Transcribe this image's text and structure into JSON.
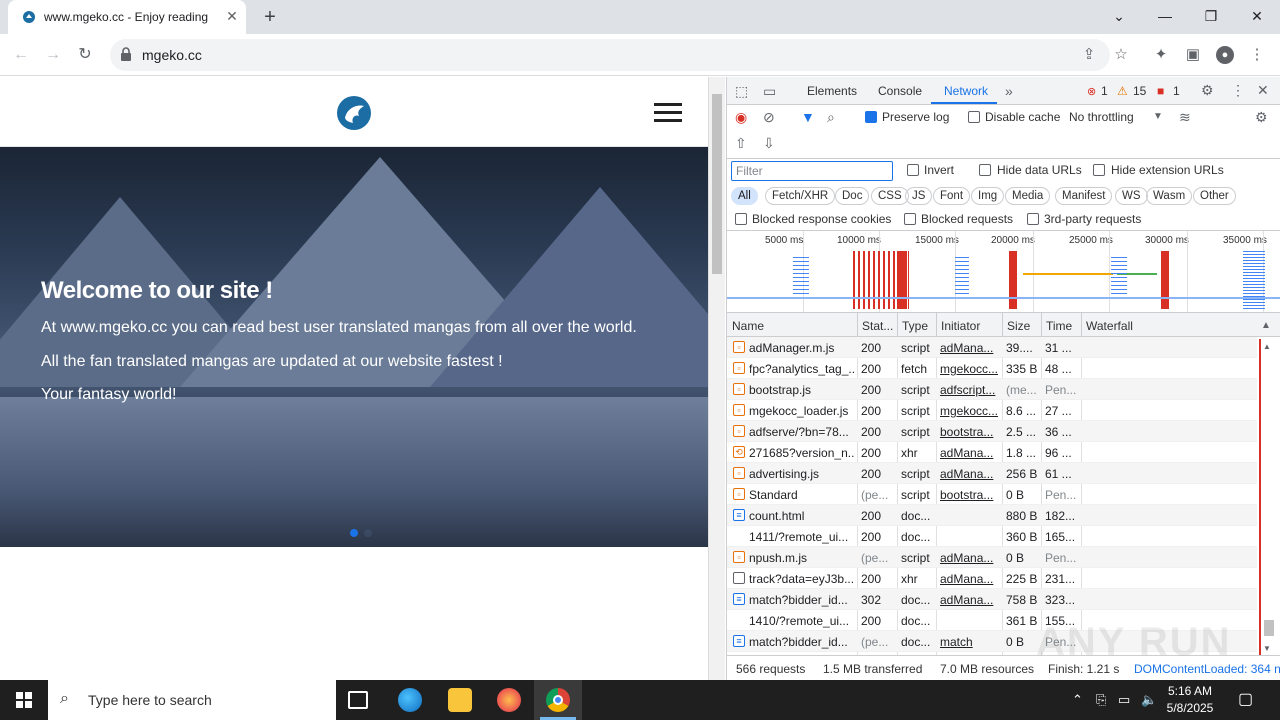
{
  "browser": {
    "tab_title": "www.mgeko.cc - Enjoy reading",
    "url": "mgeko.cc"
  },
  "page": {
    "hero_title": "Welcome to our site !",
    "hero_line1": "At www.mgeko.cc you can read best user translated mangas from all over the world.",
    "hero_line2": "All the fan translated mangas are updated at our website fastest !",
    "hero_line3": "Your fantasy world!"
  },
  "devtools": {
    "tabs": [
      "Elements",
      "Console",
      "Network"
    ],
    "active_tab": "Network",
    "errors": "1",
    "warnings": "15",
    "issues": "1",
    "preserve_log": "Preserve log",
    "disable_cache": "Disable cache",
    "throttling": "No throttling",
    "filter_placeholder": "Filter",
    "invert": "Invert",
    "hide_data_urls": "Hide data URLs",
    "hide_extension_urls": "Hide extension URLs",
    "type_filters": [
      "All",
      "Fetch/XHR",
      "Doc",
      "CSS",
      "JS",
      "Font",
      "Img",
      "Media",
      "Manifest",
      "WS",
      "Wasm",
      "Other"
    ],
    "blocked_cookies": "Blocked response cookies",
    "blocked_requests": "Blocked requests",
    "third_party": "3rd-party requests",
    "timeline_labels": [
      "5000 ms",
      "10000 ms",
      "15000 ms",
      "20000 ms",
      "25000 ms",
      "30000 ms",
      "35000 ms"
    ],
    "columns": [
      "Name",
      "Stat...",
      "Type",
      "Initiator",
      "Size",
      "Time",
      "Waterfall"
    ],
    "rows": [
      {
        "name": "adManager.m.js",
        "status": "200",
        "type": "script",
        "initiator": "adMana...",
        "size": "39....",
        "time": "31 ...",
        "icon": "script"
      },
      {
        "name": "fpc?analytics_tag_...",
        "status": "200",
        "type": "fetch",
        "initiator": "mgekocc...",
        "size": "335 B",
        "time": "48 ...",
        "icon": "script"
      },
      {
        "name": "bootstrap.js",
        "status": "200",
        "type": "script",
        "initiator": "adfscript...",
        "size": "(me...",
        "time": "Pen...",
        "icon": "script"
      },
      {
        "name": "mgekocc_loader.js",
        "status": "200",
        "type": "script",
        "initiator": "mgekocc...",
        "size": "8.6 ...",
        "time": "27 ...",
        "icon": "script"
      },
      {
        "name": "adfserve/?bn=78...",
        "status": "200",
        "type": "script",
        "initiator": "bootstra...",
        "size": "2.5 ...",
        "time": "36 ...",
        "icon": "script"
      },
      {
        "name": "271685?version_n...",
        "status": "200",
        "type": "xhr",
        "initiator": "adMana...",
        "size": "1.8 ...",
        "time": "96 ...",
        "icon": "xhr"
      },
      {
        "name": "advertising.js",
        "status": "200",
        "type": "script",
        "initiator": "adMana...",
        "size": "256 B",
        "time": "61 ...",
        "icon": "script"
      },
      {
        "name": "Standard",
        "status": "(pe...",
        "type": "script",
        "initiator": "bootstra...",
        "size": "0 B",
        "time": "Pen...",
        "icon": "script"
      },
      {
        "name": "count.html",
        "status": "200",
        "type": "doc...",
        "initiator": "",
        "size": "880 B",
        "time": "182...",
        "icon": "doc"
      },
      {
        "name": "1411/?remote_ui...",
        "status": "200",
        "type": "doc...",
        "initiator": "",
        "size": "360 B",
        "time": "165...",
        "icon": "none"
      },
      {
        "name": "npush.m.js",
        "status": "(pe...",
        "type": "script",
        "initiator": "adMana...",
        "size": "0 B",
        "time": "Pen...",
        "icon": "script"
      },
      {
        "name": "track?data=eyJ3b...",
        "status": "200",
        "type": "xhr",
        "initiator": "adMana...",
        "size": "225 B",
        "time": "231...",
        "icon": "file"
      },
      {
        "name": "match?bidder_id...",
        "status": "302",
        "type": "doc...",
        "initiator": "adMana...",
        "size": "758 B",
        "time": "323...",
        "icon": "doc"
      },
      {
        "name": "1410/?remote_ui...",
        "status": "200",
        "type": "doc...",
        "initiator": "",
        "size": "361 B",
        "time": "155...",
        "icon": "none"
      },
      {
        "name": "match?bidder_id...",
        "status": "(pe...",
        "type": "doc...",
        "initiator": "match",
        "size": "0 B",
        "time": "Pen...",
        "icon": "doc"
      }
    ],
    "status_bar": {
      "requests": "566 requests",
      "transferred": "1.5 MB transferred",
      "resources": "7.0 MB resources",
      "finish": "Finish: 1.21 s",
      "dom_loaded": "DOMContentLoaded: 364 n"
    }
  },
  "taskbar": {
    "search_placeholder": "Type here to search",
    "time": "5:16 AM",
    "date": "5/8/2025"
  },
  "watermark": "ANY RUN"
}
